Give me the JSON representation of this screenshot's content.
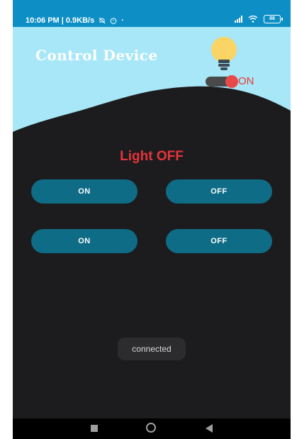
{
  "status_bar": {
    "time_speed": "10:06 PM | 0.9KB/s",
    "icons": [
      "mute-icon",
      "alarm-icon",
      "dot-icon"
    ],
    "right_icons": [
      "signal-icon",
      "wifi-icon",
      "battery-icon"
    ],
    "battery": "88"
  },
  "header": {
    "title": "Control Device",
    "bulb_icon": "light-bulb-icon",
    "toggle_label": "ON",
    "colors": {
      "sky": "#a8e7f7",
      "dark": "#1c1c1e",
      "accent_red": "#e8343a"
    }
  },
  "main": {
    "status_text": "Light OFF",
    "buttons": [
      {
        "label": "ON"
      },
      {
        "label": "OFF"
      },
      {
        "label": "ON"
      },
      {
        "label": "OFF"
      }
    ],
    "toast": "connected"
  },
  "nav": [
    "recents-icon",
    "home-icon",
    "back-icon"
  ]
}
